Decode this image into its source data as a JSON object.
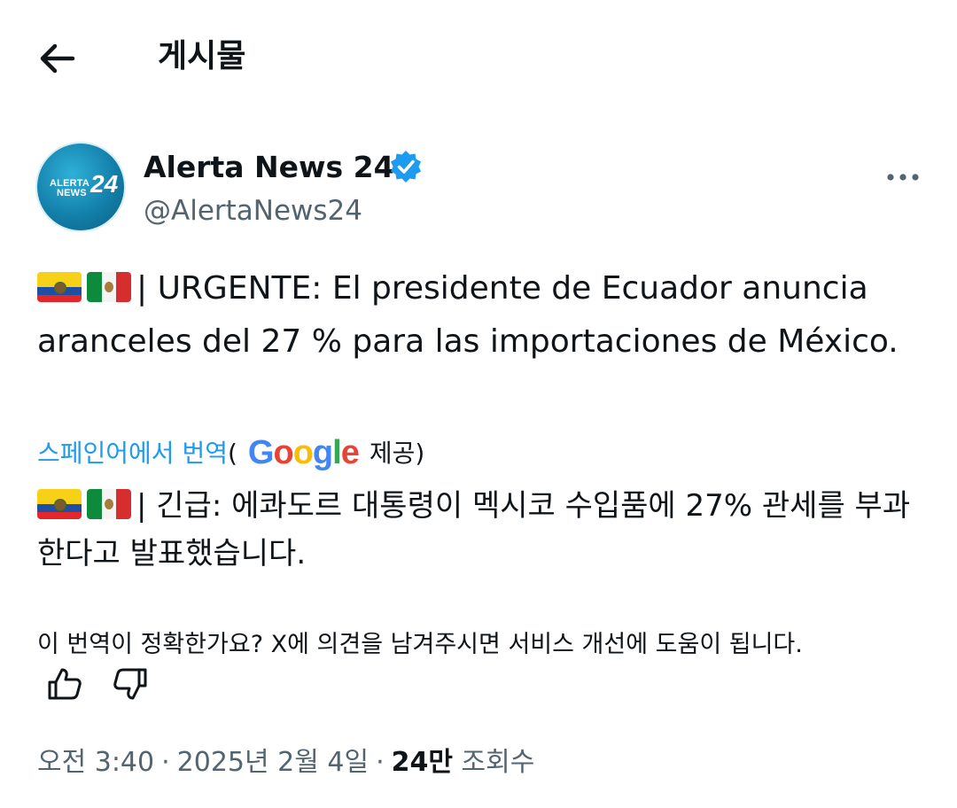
{
  "header": {
    "title": "게시물",
    "back_icon": "arrow-left-icon"
  },
  "author": {
    "display_name": "Alerta News 24",
    "handle": "@AlertaNews24",
    "verified": true,
    "avatar": {
      "line1": "ALERTA",
      "line2": "NEWS",
      "number": "24"
    },
    "more_icon": "more-horizontal-icon"
  },
  "tweet": {
    "flags": [
      "flag-ecuador",
      "flag-mexico"
    ],
    "text": "| URGENTE: El presidente de Ecuador anuncia aranceles del 27 % para las importaciones de México."
  },
  "translation": {
    "link_label": "스페인어에서 번역",
    "open_paren": "(",
    "google_letters": [
      "G",
      "o",
      "o",
      "g",
      "l",
      "e"
    ],
    "provided_label": "제공)",
    "text": "| 긴급: 에콰도르 대통령이 멕시코 수입품에 27% 관세를 부과한다고 발표했습니다.",
    "feedback_question": "이 번역이 정확한가요? X에 의견을 남겨주시면 서비스 개선에 도움이 됩니다."
  },
  "meta": {
    "time": "오전 3:40",
    "date": "2025년 2월 4일",
    "separator": "·",
    "views_count": "24만",
    "views_label": "조회수"
  },
  "colors": {
    "accent": "#1d9bf0",
    "text_primary": "#0f1419",
    "text_secondary": "#536471"
  }
}
